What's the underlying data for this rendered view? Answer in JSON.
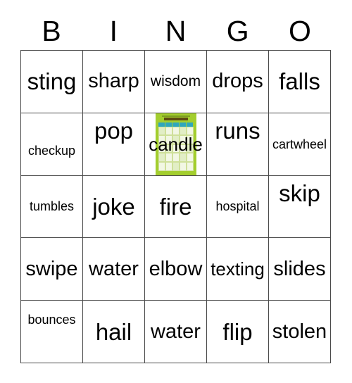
{
  "card": {
    "header_letters": [
      "B",
      "I",
      "N",
      "G",
      "O"
    ],
    "free_space_image": {
      "name": "bingo-card-thumbnail",
      "background_color": "#a3ce2e",
      "header_color": "#2fa6bd",
      "title_text": "FREE BINGO"
    },
    "rows": [
      [
        {
          "label": "sting",
          "size": "xl",
          "align": "middle"
        },
        {
          "label": "sharp",
          "size": "lg",
          "align": "middle"
        },
        {
          "label": "wisdom",
          "size": "sm",
          "align": "middle"
        },
        {
          "label": "drops",
          "size": "lg",
          "align": "middle"
        },
        {
          "label": "falls",
          "size": "xl",
          "align": "middle"
        }
      ],
      [
        {
          "label": "checkup",
          "size": "xs",
          "align": "below"
        },
        {
          "label": "pop",
          "size": "xl",
          "align": "above"
        },
        {
          "label": "candle",
          "size": "md",
          "align": "middle",
          "free_space": true
        },
        {
          "label": "runs",
          "size": "xl",
          "align": "above"
        },
        {
          "label": "cartwheel",
          "size": "xs",
          "align": "middle"
        }
      ],
      [
        {
          "label": "tumbles",
          "size": "xs",
          "align": "middle"
        },
        {
          "label": "joke",
          "size": "xl",
          "align": "middle"
        },
        {
          "label": "fire",
          "size": "xl",
          "align": "middle"
        },
        {
          "label": "hospital",
          "size": "xs",
          "align": "middle"
        },
        {
          "label": "skip",
          "size": "xl",
          "align": "above"
        }
      ],
      [
        {
          "label": "swipe",
          "size": "lg",
          "align": "middle"
        },
        {
          "label": "water",
          "size": "lg",
          "align": "middle"
        },
        {
          "label": "elbow",
          "size": "lg",
          "align": "middle"
        },
        {
          "label": "texting",
          "size": "md",
          "align": "middle"
        },
        {
          "label": "slides",
          "size": "lg",
          "align": "middle"
        }
      ],
      [
        {
          "label": "bounces",
          "size": "xs",
          "align": "above"
        },
        {
          "label": "hail",
          "size": "xl",
          "align": "middle"
        },
        {
          "label": "water",
          "size": "lg",
          "align": "middle"
        },
        {
          "label": "flip",
          "size": "xl",
          "align": "middle"
        },
        {
          "label": "stolen",
          "size": "lg",
          "align": "middle"
        }
      ]
    ]
  }
}
